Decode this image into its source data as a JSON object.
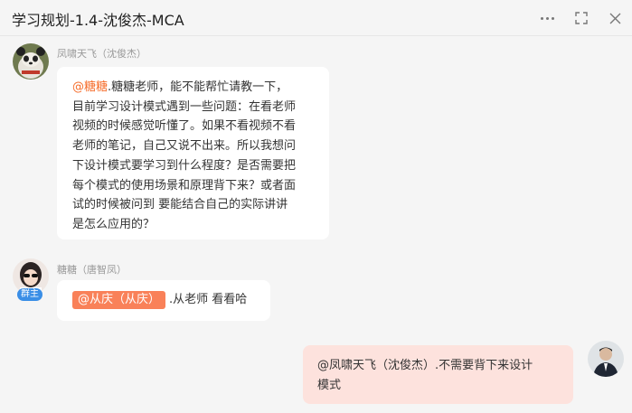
{
  "window": {
    "title": "学习规划-1.4-沈俊杰-MCA"
  },
  "messages": [
    {
      "sender": "凤啸天飞（沈俊杰）",
      "mention": "@糖糖",
      "text_lines": [
        ".糖糖老师，能不能帮忙请教一下，",
        "目前学习设计模式遇到一些问题：在看老师",
        "视频的时候感觉听懂了。如果不看视频不看",
        "老师的笔记，自己又说不出来。所以我想问",
        "下设计模式要学习到什么程度？是否需要把",
        "每个模式的使用场景和原理背下来？或者面",
        "试的时候被问到 要能结合自己的实际讲讲",
        "是怎么应用的？"
      ]
    },
    {
      "sender": "糖糖（唐智凤）",
      "badge": "群主",
      "mention_chip": "@从庆（从庆）",
      "text": ".从老师 看看哈"
    },
    {
      "sender": "me",
      "text_lines": [
        "@凤啸天飞（沈俊杰）.不需要背下来设计",
        "模式"
      ]
    }
  ]
}
